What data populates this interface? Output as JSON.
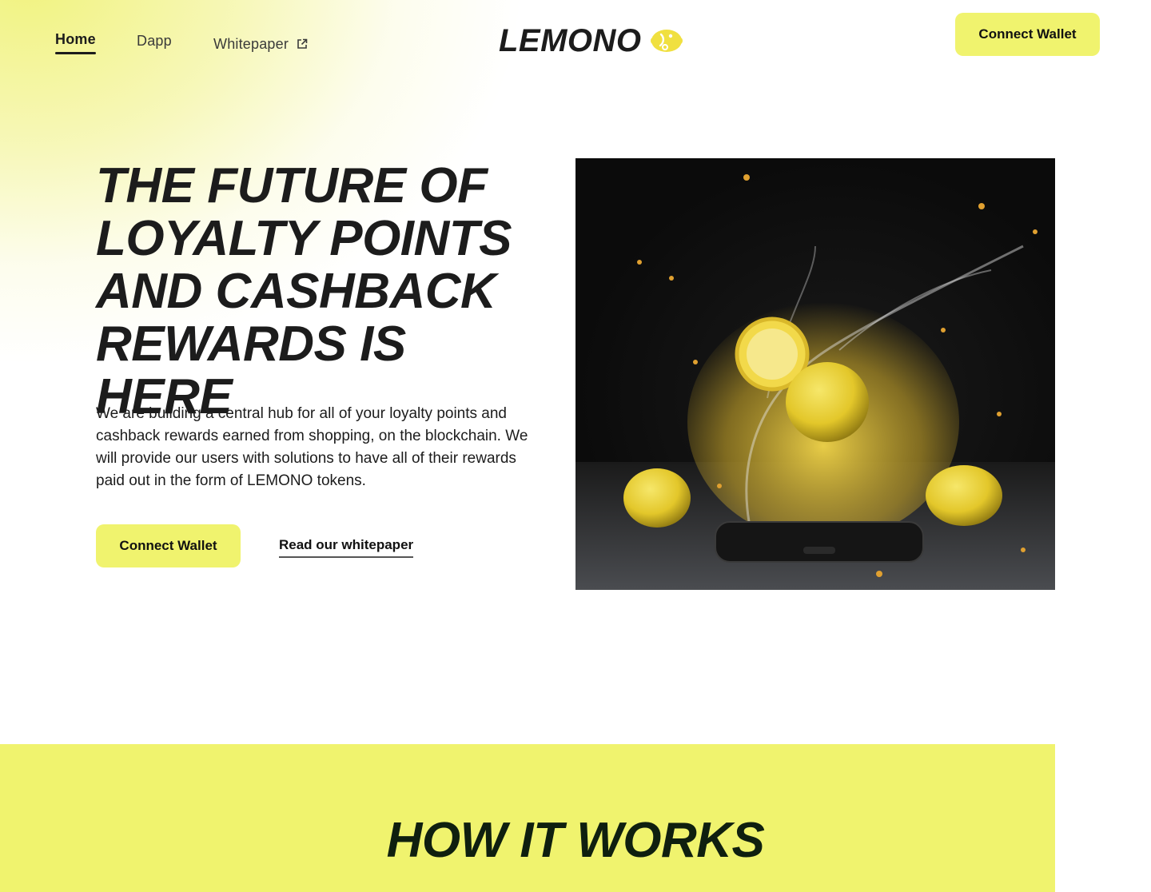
{
  "nav": {
    "links": [
      {
        "label": "Home",
        "active": true
      },
      {
        "label": "Dapp",
        "active": false
      },
      {
        "label": "Whitepaper",
        "active": false,
        "external": true
      }
    ],
    "logo_text": "LEMONO",
    "logo_icon": "lemon-icon",
    "connect_label": "Connect Wallet"
  },
  "hero": {
    "title_lines": [
      "THE FUTURE OF",
      "LOYALTY POINTS",
      "AND CASHBACK",
      "REWARDS IS HERE"
    ],
    "description": "We are building a central hub for all of your loyalty points and cashback rewards earned from shopping, on the blockchain. We will provide our users with solutions to have all of their rewards paid out in the form of LEMONO tokens.",
    "connect_label": "Connect Wallet",
    "whitepaper_link": "Read our whitepaper"
  },
  "how_it_works": {
    "title": "HOW IT WORKS"
  },
  "colors": {
    "accent": "#f0f36e",
    "text": "#1c1c1c",
    "dark": "#0f1f0f"
  }
}
